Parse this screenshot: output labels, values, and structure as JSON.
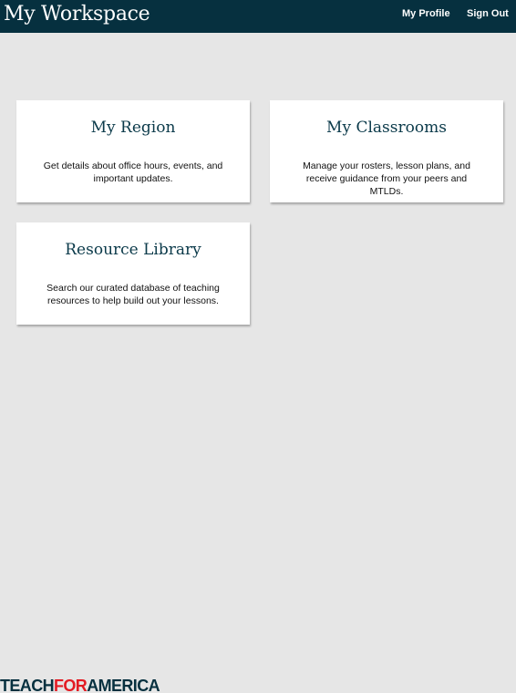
{
  "header": {
    "title": "My Workspace",
    "links": {
      "profile": "My Profile",
      "sign_out": "Sign Out"
    }
  },
  "cards": [
    {
      "title": "My Region",
      "description": "Get details about office hours, events, and important updates."
    },
    {
      "title": "My Classrooms",
      "description": "Manage your rosters, lesson plans, and receive guidance from your peers and MTLDs."
    },
    {
      "title": "Resource Library",
      "description": "Search our curated database of teaching resources to help build out your lessons."
    }
  ],
  "footer": {
    "logo": {
      "part1": "TEACH",
      "part2": "FOR",
      "part3": "AMERICA"
    }
  },
  "colors": {
    "header_bg": "#06303f",
    "page_bg": "#e6e6e6",
    "card_title": "#0b3a4a",
    "logo_red": "#e31b23"
  }
}
